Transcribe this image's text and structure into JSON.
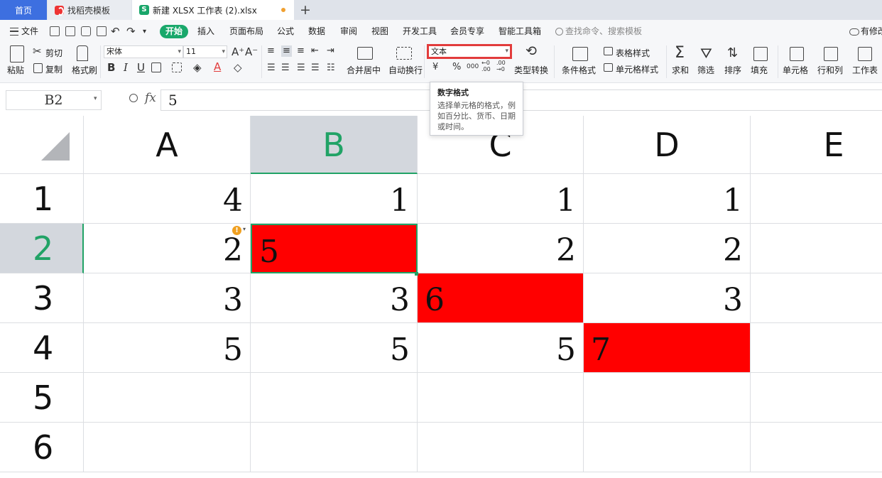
{
  "tabs": {
    "home": "首页",
    "daoke": "找稻壳模板",
    "doc": "新建 XLSX 工作表 (2).xlsx",
    "doc_icon_letter": "S",
    "add": "+"
  },
  "menu": {
    "file": "文件",
    "start": "开始",
    "insert": "插入",
    "page_layout": "页面布局",
    "formula": "公式",
    "data": "数据",
    "review": "审阅",
    "view": "视图",
    "dev_tools": "开发工具",
    "member": "会员专享",
    "smart_toolbox": "智能工具箱",
    "search_placeholder": "查找命令、搜索模板",
    "changes": "有修改"
  },
  "ribbon": {
    "cut": "剪切",
    "paste": "粘贴",
    "copy": "复制",
    "format_painter": "格式刷",
    "font_name": "宋体",
    "font_size": "11",
    "merge_center": "合并居中",
    "wrap_text": "自动换行",
    "number_format": "文本",
    "type_convert": "类型转换",
    "cond_format": "条件格式",
    "table_style": "表格样式",
    "cell_style": "单元格样式",
    "sum": "求和",
    "filter": "筛选",
    "sort": "排序",
    "fill": "填充",
    "cell": "单元格",
    "rows_cols": "行和列",
    "worksheet": "工作表",
    "currency_symbol": "¥",
    "percent_symbol": "%",
    "thousands_symbol": "000",
    "decimal_inc": "←0 .00",
    "decimal_dec": ".00 →0"
  },
  "tooltip": {
    "title": "数字格式",
    "body": "选择单元格的格式，例如百分比、货币、日期或时间。"
  },
  "formula_bar": {
    "name_box": "B2",
    "fx": "fx",
    "value": "5"
  },
  "sheet": {
    "columns": [
      "A",
      "B",
      "C",
      "D",
      "E"
    ],
    "rows": [
      "1",
      "2",
      "3",
      "4",
      "5",
      "6"
    ],
    "cells": {
      "A1": "4",
      "B1": "1",
      "C1": "1",
      "D1": "1",
      "A2": "2",
      "B2": "5",
      "C2": "2",
      "D2": "2",
      "A3": "3",
      "B3": "3",
      "C3": "6",
      "D3": "3",
      "A4": "5",
      "B4": "5",
      "C4": "5",
      "D4": "7"
    },
    "highlight_color": "#ff0000",
    "accent_color": "#21a366",
    "warning_icon": "!"
  }
}
